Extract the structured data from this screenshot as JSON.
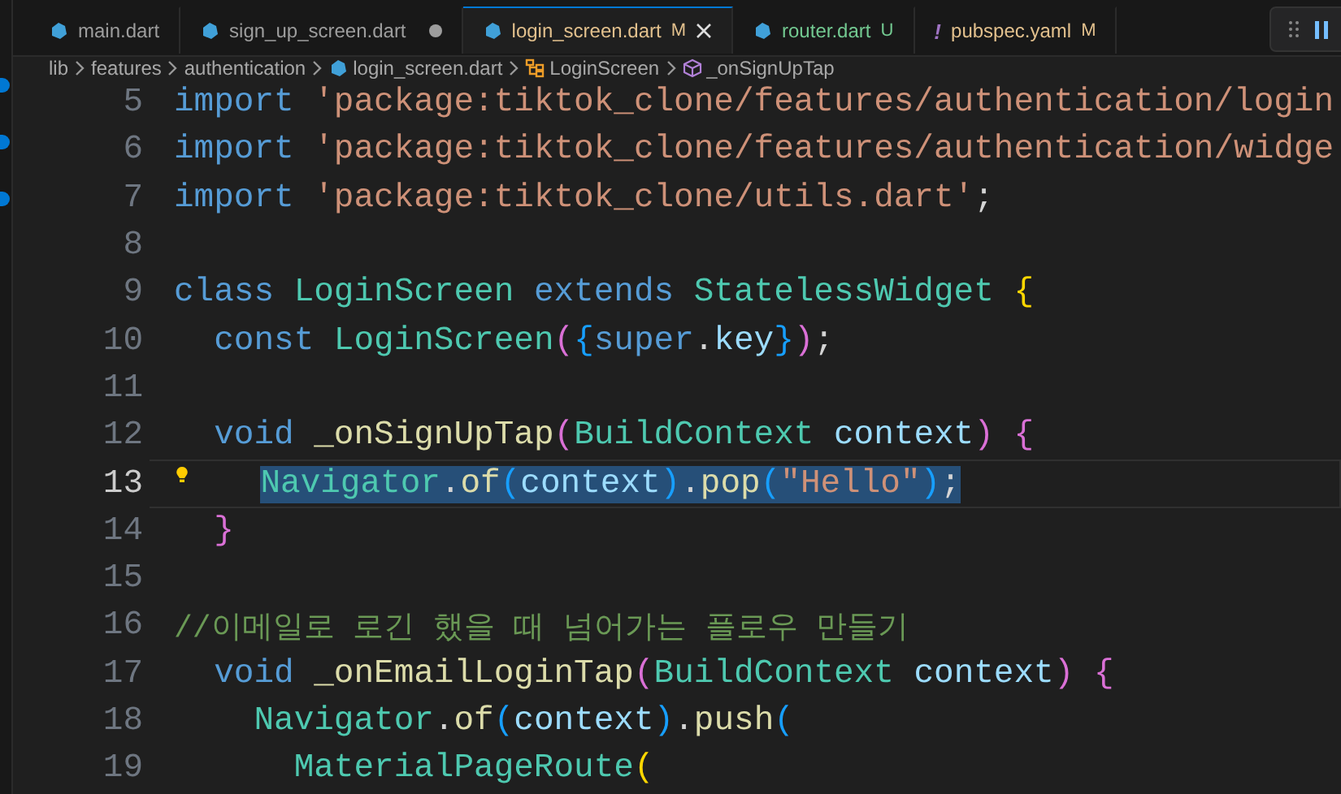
{
  "tabs": [
    {
      "label": "main.dart",
      "kind": "dart",
      "selected": false,
      "dirty": false
    },
    {
      "label": "sign_up_screen.dart",
      "kind": "dart",
      "selected": false,
      "dirty": true
    },
    {
      "label": "login_screen.dart",
      "kind": "dart",
      "selected": true,
      "dirty": false,
      "status": "M",
      "color": "#e2c08d"
    },
    {
      "label": "router.dart",
      "kind": "dart",
      "selected": false,
      "dirty": false,
      "status": "U",
      "color": "#73c991"
    },
    {
      "label": "pubspec.yaml",
      "kind": "yaml",
      "icon": "!",
      "selected": false,
      "dirty": false,
      "status": "M",
      "color": "#e2c08d"
    }
  ],
  "breadcrumbs": [
    {
      "label": "lib",
      "kind": "folder"
    },
    {
      "label": "features",
      "kind": "folder"
    },
    {
      "label": "authentication",
      "kind": "folder"
    },
    {
      "label": "login_screen.dart",
      "kind": "dart"
    },
    {
      "label": "LoginScreen",
      "kind": "class"
    },
    {
      "label": "_onSignUpTap",
      "kind": "method"
    }
  ],
  "code_lines": [
    {
      "number": "5",
      "current": false,
      "tokens": [
        {
          "text": "import ",
          "kind": "keyword"
        },
        {
          "text": "'package:tiktok_clone/features/authentication/login",
          "kind": "string"
        }
      ]
    },
    {
      "number": "6",
      "current": false,
      "tokens": [
        {
          "text": "import ",
          "kind": "keyword"
        },
        {
          "text": "'package:tiktok_clone/features/authentication/widge",
          "kind": "string"
        }
      ]
    },
    {
      "number": "7",
      "current": false,
      "tokens": [
        {
          "text": "import ",
          "kind": "keyword"
        },
        {
          "text": "'package:tiktok_clone/utils.dart'",
          "kind": "string"
        },
        {
          "text": ";",
          "kind": "plain"
        }
      ]
    },
    {
      "number": "8",
      "current": false
    },
    {
      "number": "9",
      "current": false,
      "tokens": [
        {
          "text": "class ",
          "kind": "keyword"
        },
        {
          "text": "LoginScreen ",
          "kind": "type"
        },
        {
          "text": "extends ",
          "kind": "keyword"
        },
        {
          "text": "StatelessWidget ",
          "kind": "type"
        },
        {
          "text": "{",
          "kind": "bracket1"
        }
      ]
    },
    {
      "number": "10",
      "current": false,
      "tokens": [
        {
          "text": "  const ",
          "kind": "keyword"
        },
        {
          "text": "LoginScreen",
          "kind": "type"
        },
        {
          "text": "(",
          "kind": "bracket2"
        },
        {
          "text": "{",
          "kind": "bracket3"
        },
        {
          "text": "super",
          "kind": "keyword"
        },
        {
          "text": ".",
          "kind": "plain"
        },
        {
          "text": "key",
          "kind": "variable"
        },
        {
          "text": "}",
          "kind": "bracket3"
        },
        {
          "text": ")",
          "kind": "bracket2"
        },
        {
          "text": ";",
          "kind": "plain"
        }
      ]
    },
    {
      "number": "11",
      "current": false
    },
    {
      "number": "12",
      "current": false,
      "tokens": [
        {
          "text": "  void ",
          "kind": "keyword"
        },
        {
          "text": "_onSignUpTap",
          "kind": "function"
        },
        {
          "text": "(",
          "kind": "bracket2"
        },
        {
          "text": "BuildContext ",
          "kind": "type"
        },
        {
          "text": "context",
          "kind": "variable"
        },
        {
          "text": ") ",
          "kind": "bracket2"
        },
        {
          "text": "{",
          "kind": "bracket2"
        }
      ]
    },
    {
      "number": "13",
      "current": true,
      "bulb": true,
      "selection": true,
      "tokens": [
        {
          "text": "    Navigator",
          "kind": "type"
        },
        {
          "text": ".",
          "kind": "plain"
        },
        {
          "text": "of",
          "kind": "function"
        },
        {
          "text": "(",
          "kind": "bracket3"
        },
        {
          "text": "context",
          "kind": "variable"
        },
        {
          "text": ")",
          "kind": "bracket3"
        },
        {
          "text": ".",
          "kind": "plain"
        },
        {
          "text": "pop",
          "kind": "function"
        },
        {
          "text": "(",
          "kind": "bracket3"
        },
        {
          "text": "\"Hello\"",
          "kind": "string"
        },
        {
          "text": ")",
          "kind": "bracket3"
        },
        {
          "text": ";",
          "kind": "plain"
        }
      ]
    },
    {
      "number": "14",
      "current": false,
      "tokens": [
        {
          "text": "  }",
          "kind": "bracket2"
        }
      ]
    },
    {
      "number": "15",
      "current": false
    },
    {
      "number": "16",
      "current": false,
      "tokens": [
        {
          "text": "//이메일로 로긴 했을 때 넘어가는 플로우 만들기",
          "kind": "comment"
        }
      ]
    },
    {
      "number": "17",
      "current": false,
      "tokens": [
        {
          "text": "  void ",
          "kind": "keyword"
        },
        {
          "text": "_onEmailLoginTap",
          "kind": "function"
        },
        {
          "text": "(",
          "kind": "bracket2"
        },
        {
          "text": "BuildContext ",
          "kind": "type"
        },
        {
          "text": "context",
          "kind": "variable"
        },
        {
          "text": ") ",
          "kind": "bracket2"
        },
        {
          "text": "{",
          "kind": "bracket2"
        }
      ]
    },
    {
      "number": "18",
      "current": false,
      "tokens": [
        {
          "text": "    Navigator",
          "kind": "type"
        },
        {
          "text": ".",
          "kind": "plain"
        },
        {
          "text": "of",
          "kind": "function"
        },
        {
          "text": "(",
          "kind": "bracket3"
        },
        {
          "text": "context",
          "kind": "variable"
        },
        {
          "text": ")",
          "kind": "bracket3"
        },
        {
          "text": ".",
          "kind": "plain"
        },
        {
          "text": "push",
          "kind": "function"
        },
        {
          "text": "(",
          "kind": "bracket3"
        }
      ]
    },
    {
      "number": "19",
      "current": false,
      "tokens": [
        {
          "text": "      MaterialPageRoute",
          "kind": "type"
        },
        {
          "text": "(",
          "kind": "bracket1"
        }
      ]
    }
  ]
}
